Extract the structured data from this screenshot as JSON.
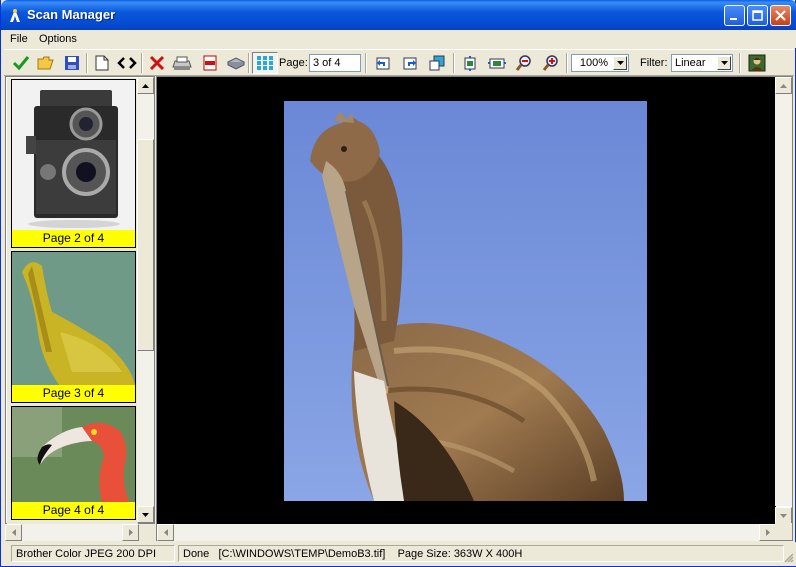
{
  "window": {
    "title": "Scan Manager"
  },
  "menu": {
    "file": "File",
    "options": "Options"
  },
  "toolbar": {
    "page_label": "Page:",
    "page_value": "3 of 4",
    "zoom_value": "100%",
    "filter_label": "Filter:",
    "filter_value": "Linear"
  },
  "thumbnails": [
    {
      "caption": "Page 2 of 4",
      "subject": "camera"
    },
    {
      "caption": "Page 3 of 4",
      "subject": "pelican"
    },
    {
      "caption": "Page 4 of 4",
      "subject": "flamingo"
    }
  ],
  "status": {
    "device": "Brother Color JPEG 200 DPI",
    "state": "Done",
    "path": "[C:\\WINDOWS\\TEMP\\DemoB3.tif]",
    "page_size": "Page Size: 363W X 400H"
  },
  "colors": {
    "caption_bg": "#ffff00",
    "canvas_bg": "#000000",
    "sky": "#6f8fd8"
  }
}
